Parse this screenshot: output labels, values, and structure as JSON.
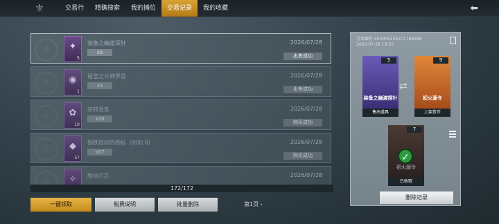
{
  "header": {
    "tabs": [
      {
        "label": "交易行"
      },
      {
        "label": "精确搜索"
      },
      {
        "label": "我的摊位"
      },
      {
        "label": "交易记录"
      },
      {
        "label": "我的收藏"
      }
    ],
    "active_tab": 3
  },
  "records": [
    {
      "name": "装备之幽渡探针",
      "qty": "x5",
      "thumb_qty": "5",
      "date": "2026/07/28",
      "status": "出售成功",
      "icon": "probe-icon"
    },
    {
      "name": "秘宝之众神罗盘",
      "qty": "x1",
      "thumb_qty": "1",
      "date": "2026/07/28",
      "status": "出售成功",
      "icon": "compass-icon"
    },
    {
      "name": "逆转发条",
      "qty": "x10",
      "thumb_qty": "10",
      "date": "2026/07/28",
      "status": "购买成功",
      "icon": "clockwork-icon"
    },
    {
      "name": "钢铁炼狱的困标（时刻 8）",
      "qty": "x57",
      "thumb_qty": "57",
      "date": "2026/07/28",
      "status": "购买成功",
      "icon": "crystal-icon"
    },
    {
      "name": "脱丝灯芯",
      "qty": "",
      "thumb_qty": "",
      "date": "2026/07/28",
      "status": "",
      "icon": "wick-icon"
    }
  ],
  "pager": {
    "count": "172/172",
    "page": "第1页"
  },
  "buttons": {
    "collect_all": "一键领取",
    "tax_info": "税费说明",
    "batch_delete": "批量删除"
  },
  "detail": {
    "order_number": "订单编号 950905135371788288",
    "order_time": "2026-07-28 19:33",
    "sold_card": {
      "count": "5",
      "title": "装备之幽渡探针",
      "caption": "售出道具"
    },
    "price_card": {
      "count": "9",
      "title": "初火源令",
      "caption": "上架货币"
    },
    "received_card": {
      "count": "7",
      "title": "初火源令",
      "caption": "已收取"
    },
    "delete_label": "删除记录"
  },
  "colors": {
    "accent": "#d9a235",
    "sold_card": "#4a3c86",
    "price_card": "#d0712a"
  }
}
